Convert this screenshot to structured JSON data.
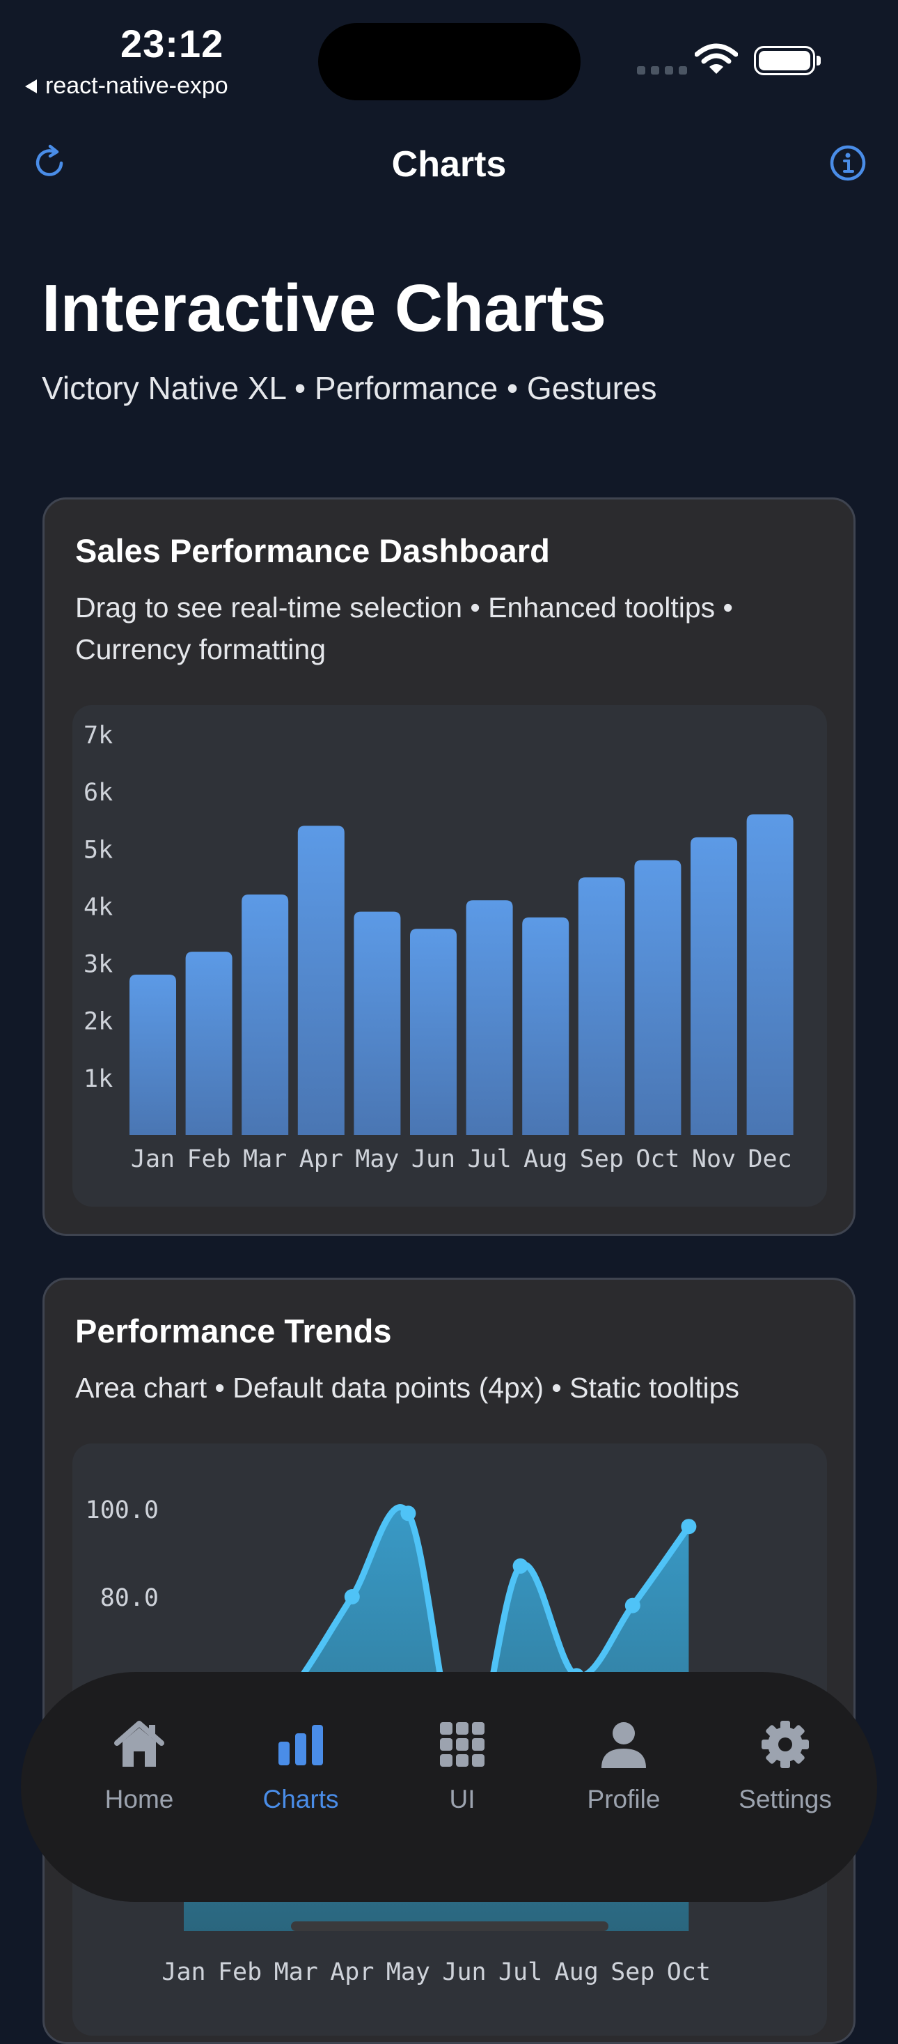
{
  "status_bar": {
    "time": "23:12",
    "back_app": "react-native-expo"
  },
  "nav": {
    "title": "Charts",
    "refresh_icon": "refresh-icon",
    "info_icon": "info-icon"
  },
  "header": {
    "title": "Interactive Charts",
    "subtitle": "Victory Native XL • Performance • Gestures"
  },
  "colors": {
    "accent": "#4a8de8",
    "bar": "#5593db",
    "area_line": "#4fc3f7",
    "background": "#111827",
    "card": "#2b2b2e"
  },
  "cards": [
    {
      "title": "Sales Performance Dashboard",
      "description": "Drag to see real-time selection • Enhanced tooltips • Currency formatting"
    },
    {
      "title": "Performance Trends",
      "description": "Area chart • Default data points (4px) • Static tooltips"
    }
  ],
  "chart_data": [
    {
      "type": "bar",
      "title": "Sales Performance Dashboard",
      "categories": [
        "Jan",
        "Feb",
        "Mar",
        "Apr",
        "May",
        "Jun",
        "Jul",
        "Aug",
        "Sep",
        "Oct",
        "Nov",
        "Dec"
      ],
      "values": [
        2800,
        3200,
        4200,
        5400,
        3900,
        3600,
        4100,
        3800,
        4500,
        4800,
        5200,
        5600
      ],
      "y_ticks": [
        "1k",
        "2k",
        "3k",
        "4k",
        "5k",
        "6k",
        "7k"
      ],
      "ylim": [
        0,
        7000
      ],
      "grid": false
    },
    {
      "type": "area",
      "title": "Performance Trends",
      "categories": [
        "Jan",
        "Feb",
        "Mar",
        "Apr",
        "May",
        "Jun",
        "Jul",
        "Aug",
        "Sep",
        "Oct"
      ],
      "values": [
        55,
        45,
        60,
        80,
        99,
        40,
        87,
        62,
        78,
        96
      ],
      "y_ticks": [
        "100.0",
        "80.0"
      ],
      "grid": false
    }
  ],
  "tabbar": {
    "items": [
      {
        "label": "Home",
        "icon": "home-icon",
        "active": false
      },
      {
        "label": "Charts",
        "icon": "bar-chart-icon",
        "active": true
      },
      {
        "label": "UI",
        "icon": "grid-icon",
        "active": false
      },
      {
        "label": "Profile",
        "icon": "person-icon",
        "active": false
      },
      {
        "label": "Settings",
        "icon": "gear-icon",
        "active": false
      }
    ]
  }
}
